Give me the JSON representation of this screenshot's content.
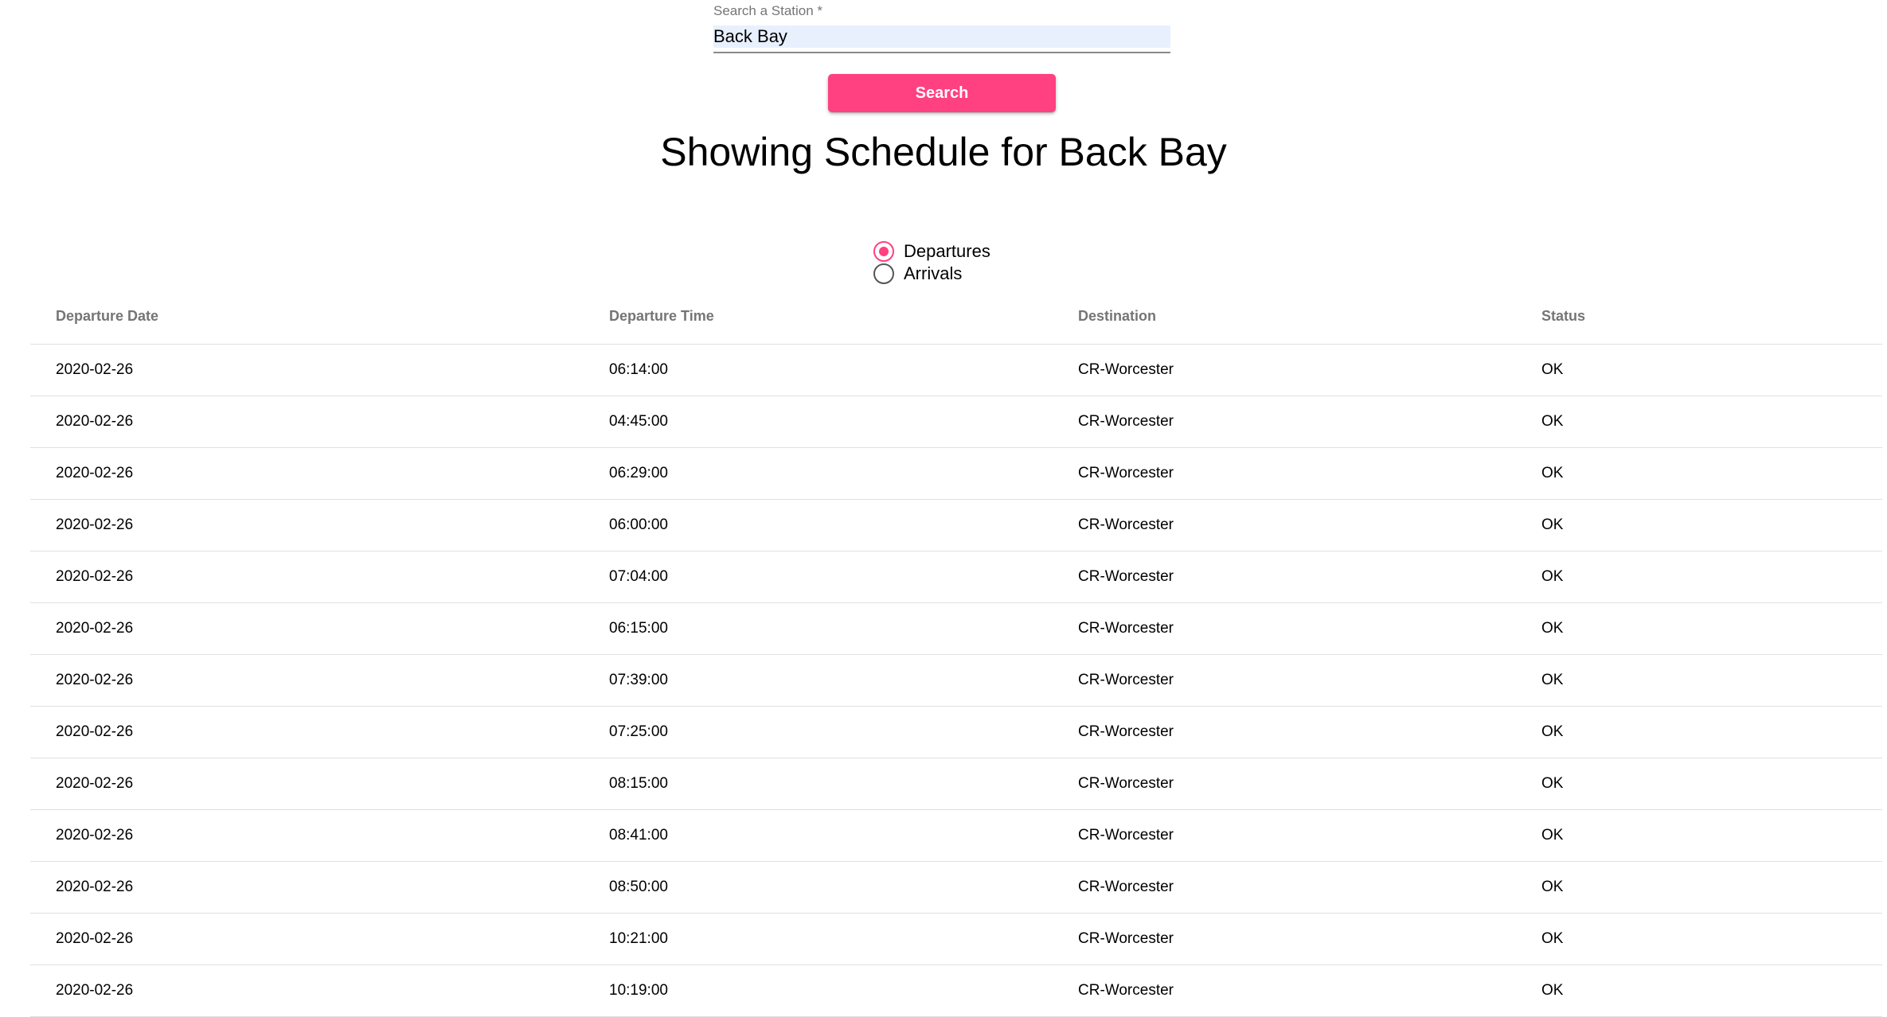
{
  "search": {
    "label": "Search a Station *",
    "value": "Back Bay",
    "button_label": "Search"
  },
  "heading": "Showing Schedule for Back Bay",
  "direction": {
    "selected": "Departures",
    "options": [
      {
        "label": "Departures",
        "checked": true
      },
      {
        "label": "Arrivals",
        "checked": false
      }
    ]
  },
  "colors": {
    "accent": "#ff4081",
    "input_autofill_bg": "#e8f0fe",
    "header_text": "#757575",
    "row_divider": "#e0e0e0"
  },
  "table": {
    "columns": [
      "Departure Date",
      "Departure Time",
      "Destination",
      "Status"
    ],
    "rows": [
      [
        "2020-02-26",
        "06:14:00",
        "CR-Worcester",
        "OK"
      ],
      [
        "2020-02-26",
        "04:45:00",
        "CR-Worcester",
        "OK"
      ],
      [
        "2020-02-26",
        "06:29:00",
        "CR-Worcester",
        "OK"
      ],
      [
        "2020-02-26",
        "06:00:00",
        "CR-Worcester",
        "OK"
      ],
      [
        "2020-02-26",
        "07:04:00",
        "CR-Worcester",
        "OK"
      ],
      [
        "2020-02-26",
        "06:15:00",
        "CR-Worcester",
        "OK"
      ],
      [
        "2020-02-26",
        "07:39:00",
        "CR-Worcester",
        "OK"
      ],
      [
        "2020-02-26",
        "07:25:00",
        "CR-Worcester",
        "OK"
      ],
      [
        "2020-02-26",
        "08:15:00",
        "CR-Worcester",
        "OK"
      ],
      [
        "2020-02-26",
        "08:41:00",
        "CR-Worcester",
        "OK"
      ],
      [
        "2020-02-26",
        "08:50:00",
        "CR-Worcester",
        "OK"
      ],
      [
        "2020-02-26",
        "10:21:00",
        "CR-Worcester",
        "OK"
      ],
      [
        "2020-02-26",
        "10:19:00",
        "CR-Worcester",
        "OK"
      ]
    ]
  }
}
